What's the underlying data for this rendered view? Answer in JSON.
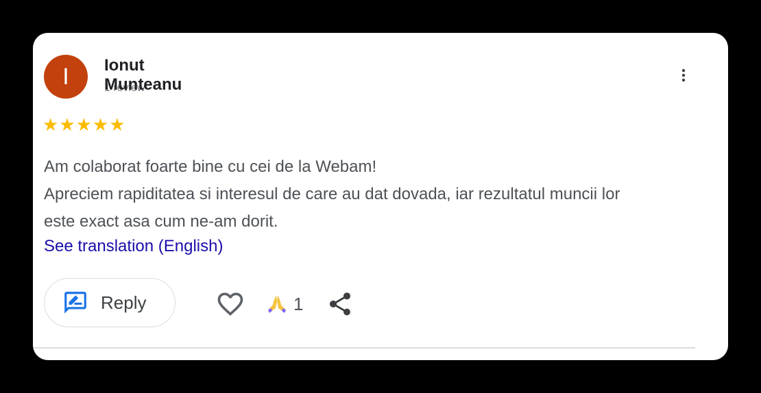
{
  "review": {
    "avatar_initial": "I",
    "avatar_color": "#c2410c",
    "author_name": "Ionut Munteanu",
    "author_subtitle": "1 review",
    "rating": 5,
    "stars_text": "★★★★★",
    "star_color": "#fbbc04",
    "text_lines": [
      "Am colaborat foarte bine cu cei de la Webam!",
      "Apreciem rapiditatea si interesul de care au dat dovada, iar rezultatul muncii lor",
      "este exact asa cum ne-am dorit."
    ],
    "translate_link": "See translation (English)"
  },
  "actions": {
    "reply_label": "Reply",
    "reaction_count": "1",
    "icons": {
      "reply": "rate-review-icon",
      "like": "heart-outline-icon",
      "reaction": "folded-hands-emoji-icon",
      "share": "share-icon",
      "more": "more-vertical-icon"
    }
  }
}
